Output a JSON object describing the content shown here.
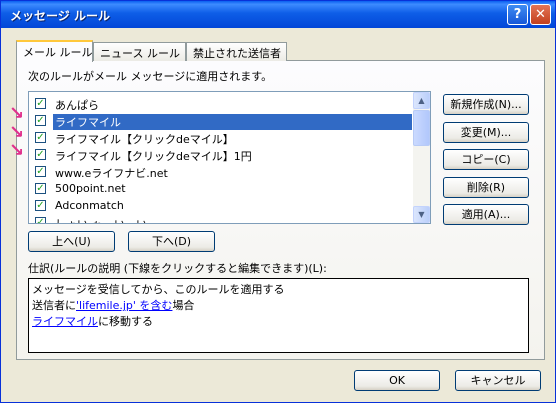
{
  "window": {
    "title": "メッセージ ルール",
    "help_icon": "?",
    "close_icon": "✕"
  },
  "tabs": [
    {
      "label": "メール ルール",
      "active": true
    },
    {
      "label": "ニュース ルール",
      "active": false
    },
    {
      "label": "禁止された送信者",
      "active": false
    }
  ],
  "rules_caption": "次のルールがメール メッセージに適用されます。",
  "rules": [
    {
      "label": "あんぱら",
      "checked": true,
      "selected": false
    },
    {
      "label": "ライフマイル",
      "checked": true,
      "selected": true
    },
    {
      "label": "ライフマイル【クリックdeマイル】",
      "checked": true,
      "selected": false
    },
    {
      "label": "ライフマイル【クリックdeマイル】1円",
      "checked": true,
      "selected": false
    },
    {
      "label": "www.eライフナビ.net",
      "checked": true,
      "selected": false
    },
    {
      "label": "500point.net",
      "checked": true,
      "selected": false
    },
    {
      "label": "Adconmatch",
      "checked": true,
      "selected": false
    },
    {
      "label": "しょい-ゎーいーい",
      "checked": true,
      "selected": false
    }
  ],
  "buttons": {
    "new": "新規作成(N)...",
    "modify": "変更(M)...",
    "copy": "コピー(C)",
    "remove": "削除(R)",
    "apply": "適用(A)...",
    "move_up": "上へ(U)",
    "move_down": "下へ(D)",
    "ok": "OK",
    "cancel": "キャンセル"
  },
  "description_caption": "仕訳(ルールの説明 (下線をクリックすると編集できます)(L):",
  "description": {
    "line1": "メッセージを受信してから、このルールを適用する",
    "line2_prefix": "送信者に",
    "line2_link": "'lifemile.jp' を含む",
    "line2_suffix": "場合",
    "line3_link": "ライフマイル",
    "line3_suffix": "に移動する"
  },
  "colors": {
    "title_bar": "#0a5ff0",
    "selection": "#316ac5",
    "arrow": "#e0308c",
    "link": "#0000ff"
  },
  "annotation_arrow": "↘"
}
